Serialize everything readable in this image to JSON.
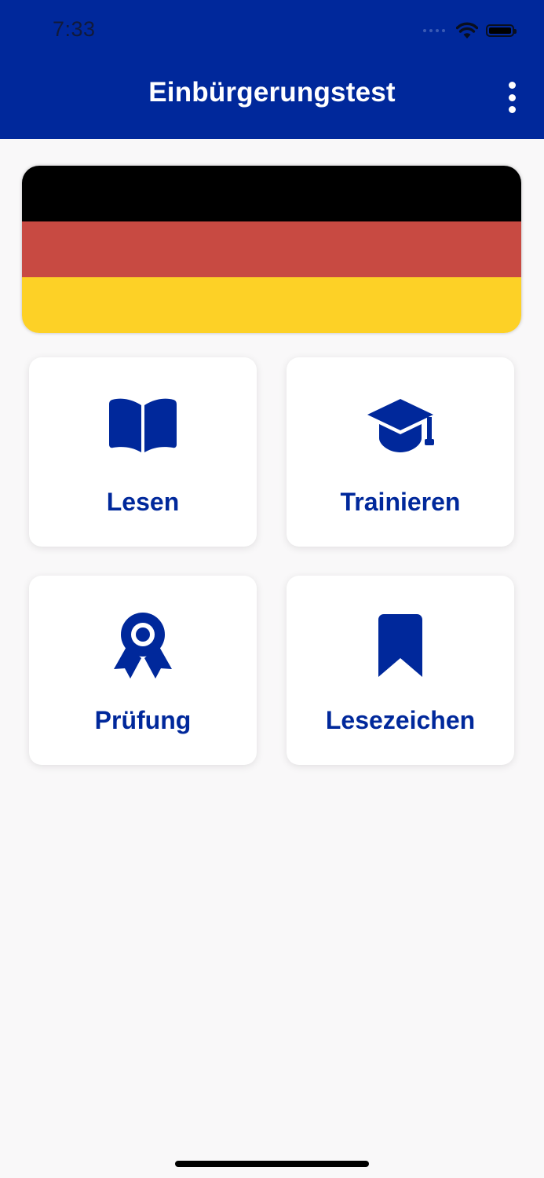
{
  "status_bar": {
    "time": "7:33"
  },
  "header": {
    "title": "Einbürgerungstest",
    "menu_icon": "more-vertical-icon"
  },
  "banner": {
    "icon": "german-flag",
    "colors": [
      "#000000",
      "#c84a42",
      "#fdd126"
    ]
  },
  "menu": {
    "items": [
      {
        "label": "Lesen",
        "icon": "open-book-icon"
      },
      {
        "label": "Trainieren",
        "icon": "graduation-cap-icon"
      },
      {
        "label": "Prüfung",
        "icon": "award-ribbon-icon"
      },
      {
        "label": "Lesezeichen",
        "icon": "bookmark-icon"
      }
    ]
  },
  "colors": {
    "primary": "#00289b",
    "background": "#f9f8f9",
    "card": "#ffffff"
  }
}
